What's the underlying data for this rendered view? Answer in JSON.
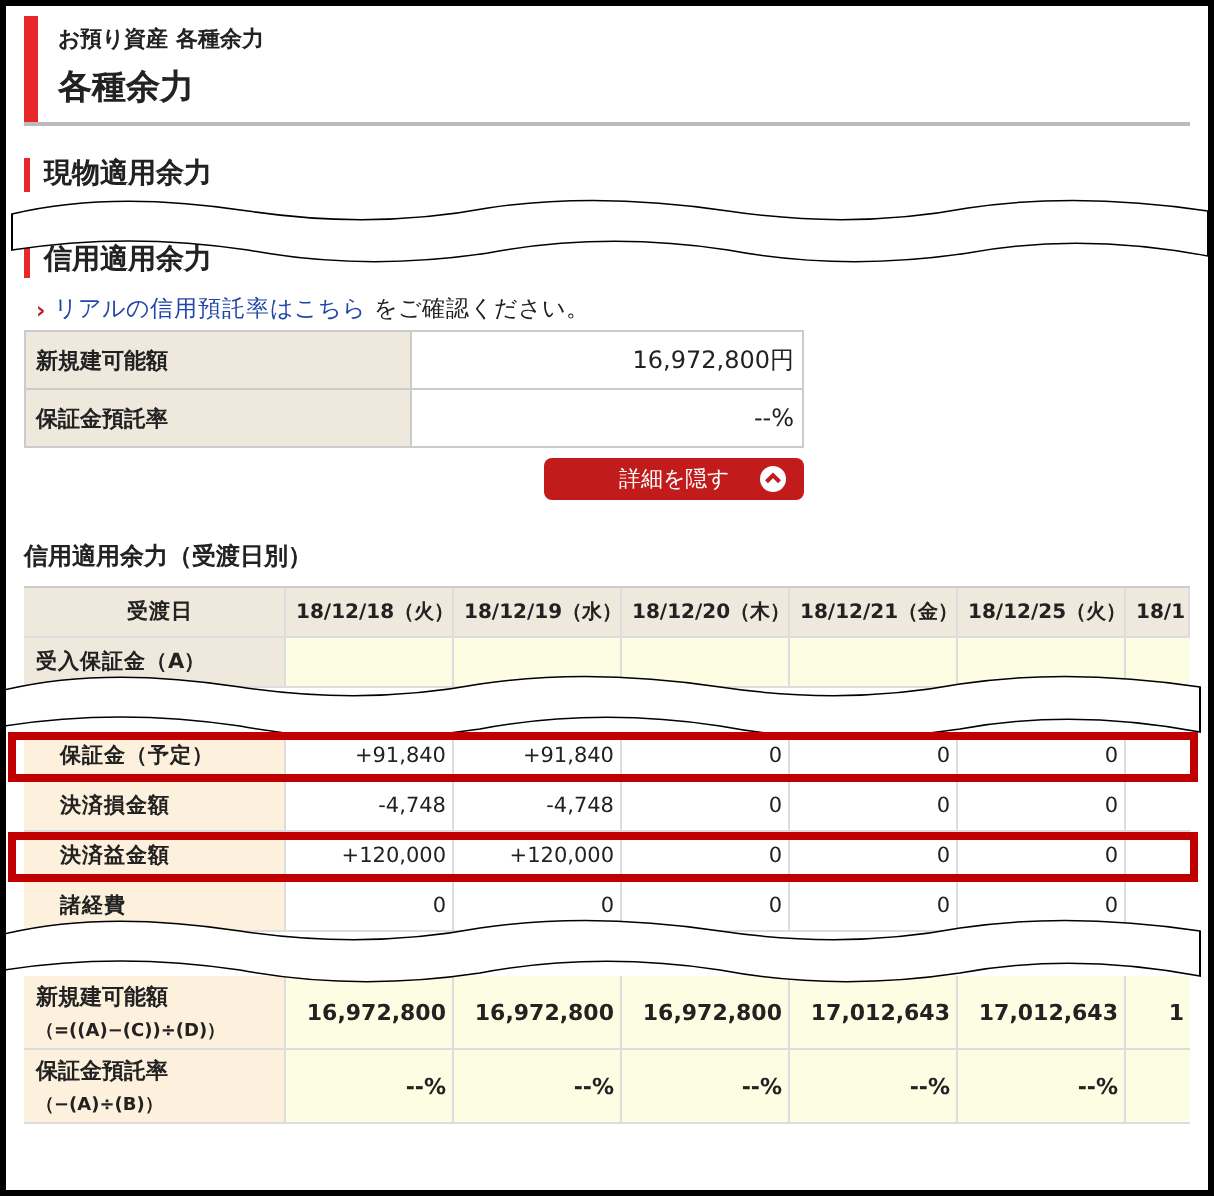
{
  "header": {
    "breadcrumb": "お預り資産 各種余力",
    "title": "各種余力"
  },
  "cash_section": {
    "title": "現物適用余力"
  },
  "margin_section": {
    "title": "信用適用余力",
    "notice": {
      "marker": "›",
      "link": "リアルの信用預託率はこちら",
      "text": "をご確認ください。"
    },
    "summary": [
      {
        "label": "新規建可能額",
        "value": "16,972,800円"
      },
      {
        "label": "保証金預託率",
        "value": "--%"
      }
    ],
    "toggle_button": {
      "label": "詳細を隠す"
    }
  },
  "daily_table": {
    "title": "信用適用余力（受渡日別）",
    "columns": [
      "受渡日",
      "18/12/18（火）",
      "18/12/19（水）",
      "18/12/20（木）",
      "18/12/21（金）",
      "18/12/25（火）",
      "18/1"
    ],
    "rows": [
      {
        "kind": "group",
        "highlighted": false,
        "label": "受入保証金（A）"
      },
      {
        "kind": "break"
      },
      {
        "kind": "item",
        "highlighted": true,
        "label": "保証金（予定）",
        "values": [
          "+91,840",
          "+91,840",
          "0",
          "0",
          "0"
        ]
      },
      {
        "kind": "item",
        "highlighted": false,
        "label": "決済損金額",
        "values": [
          "-4,748",
          "-4,748",
          "0",
          "0",
          "0"
        ]
      },
      {
        "kind": "item",
        "highlighted": true,
        "label": "決済益金額",
        "values": [
          "+120,000",
          "+120,000",
          "0",
          "0",
          "0"
        ]
      },
      {
        "kind": "item",
        "highlighted": false,
        "label": "諸経費",
        "values": [
          "0",
          "0",
          "0",
          "0",
          "0"
        ]
      },
      {
        "kind": "break"
      },
      {
        "kind": "total",
        "highlighted": false,
        "label": "新規建可能額",
        "formula": "（=((A)−(C))÷(D)）",
        "values": [
          "16,972,800",
          "16,972,800",
          "16,972,800",
          "17,012,643",
          "17,012,643",
          "1"
        ]
      },
      {
        "kind": "total",
        "highlighted": false,
        "label": "保証金預託率",
        "formula": "（−(A)÷(B)）",
        "values": [
          "--%",
          "--%",
          "--%",
          "--%",
          "--%"
        ]
      }
    ]
  }
}
